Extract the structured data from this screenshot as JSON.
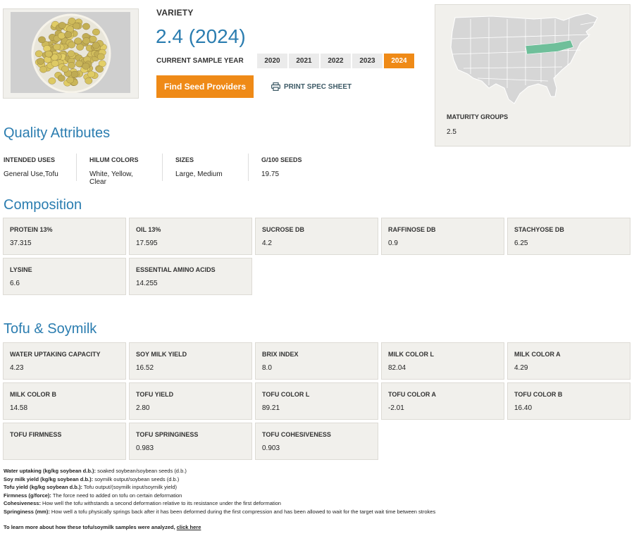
{
  "header": {
    "variety_label": "VARIETY",
    "variety_value": "2.4 (2024)",
    "sample_year_label": "CURRENT SAMPLE YEAR",
    "years": [
      "2020",
      "2021",
      "2022",
      "2023",
      "2024"
    ],
    "active_year": "2024",
    "find_seed_button": "Find Seed Providers",
    "print_link": "PRINT SPEC SHEET"
  },
  "map_panel": {
    "maturity_label": "MATURITY GROUPS",
    "maturity_value": "2.5",
    "map_color": "#d9d9d9",
    "highlight_color": "#6fbf9a"
  },
  "quality": {
    "title": "Quality Attributes",
    "attributes": [
      {
        "label": "INTENDED USES",
        "value": "General Use,Tofu"
      },
      {
        "label": "HILUM COLORS",
        "value": "White, Yellow, Clear"
      },
      {
        "label": "SIZES",
        "value": "Large, Medium"
      },
      {
        "label": "G/100 SEEDS",
        "value": "19.75"
      }
    ]
  },
  "composition": {
    "title": "Composition",
    "cards": [
      {
        "label": "PROTEIN 13%",
        "value": "37.315"
      },
      {
        "label": "OIL 13%",
        "value": "17.595"
      },
      {
        "label": "SUCROSE DB",
        "value": "4.2"
      },
      {
        "label": "RAFFINOSE DB",
        "value": "0.9"
      },
      {
        "label": "STACHYOSE DB",
        "value": "6.25"
      },
      {
        "label": "LYSINE",
        "value": "6.6"
      },
      {
        "label": "ESSENTIAL AMINO ACIDS",
        "value": "14.255"
      }
    ]
  },
  "tofu": {
    "title": "Tofu & Soymilk",
    "cards": [
      {
        "label": "WATER UPTAKING CAPACITY",
        "value": "4.23"
      },
      {
        "label": "SOY MILK YIELD",
        "value": "16.52"
      },
      {
        "label": "BRIX INDEX",
        "value": "8.0"
      },
      {
        "label": "MILK COLOR L",
        "value": "82.04"
      },
      {
        "label": "MILK COLOR A",
        "value": "4.29"
      },
      {
        "label": "MILK COLOR B",
        "value": "14.58"
      },
      {
        "label": "TOFU YIELD",
        "value": "2.80"
      },
      {
        "label": "TOFU COLOR L",
        "value": "89.21"
      },
      {
        "label": "TOFU COLOR A",
        "value": "-2.01"
      },
      {
        "label": "TOFU COLOR B",
        "value": "16.40"
      },
      {
        "label": "TOFU FIRMNESS",
        "value": ""
      },
      {
        "label": "TOFU SPRINGINESS",
        "value": "0.983"
      },
      {
        "label": "TOFU COHESIVENESS",
        "value": "0.903"
      }
    ]
  },
  "notes": [
    {
      "term": "Water uptaking (kg/kg soybean d.b.):",
      "text": " soaked soybean/soybean seeds (d.b.)"
    },
    {
      "term": "Soy milk yield (kg/kg soybean d.b.):",
      "text": " soymilk output/soybean seeds (d.b.)"
    },
    {
      "term": "Tofu yield (kg/kg soybean d.b.):",
      "text": " Tofu output/(soymilk input/soymilk yield)"
    },
    {
      "term": "Firmness (g/force):",
      "text": " The force need to added on tofu on certain deformation"
    },
    {
      "term": "Cohesiveness:",
      "text": " How well the tofu withstands a second deformation relative to its resistance under the first deformation"
    },
    {
      "term": "Springiness (mm):",
      "text": " How well a tofu physically springs back after it has been deformed during the first compression and has been allowed to wait for the target wait time between strokes"
    }
  ],
  "learn_more": {
    "text": "To learn more about how these tofu/soymilk samples were analyzed, ",
    "link": "click here"
  }
}
